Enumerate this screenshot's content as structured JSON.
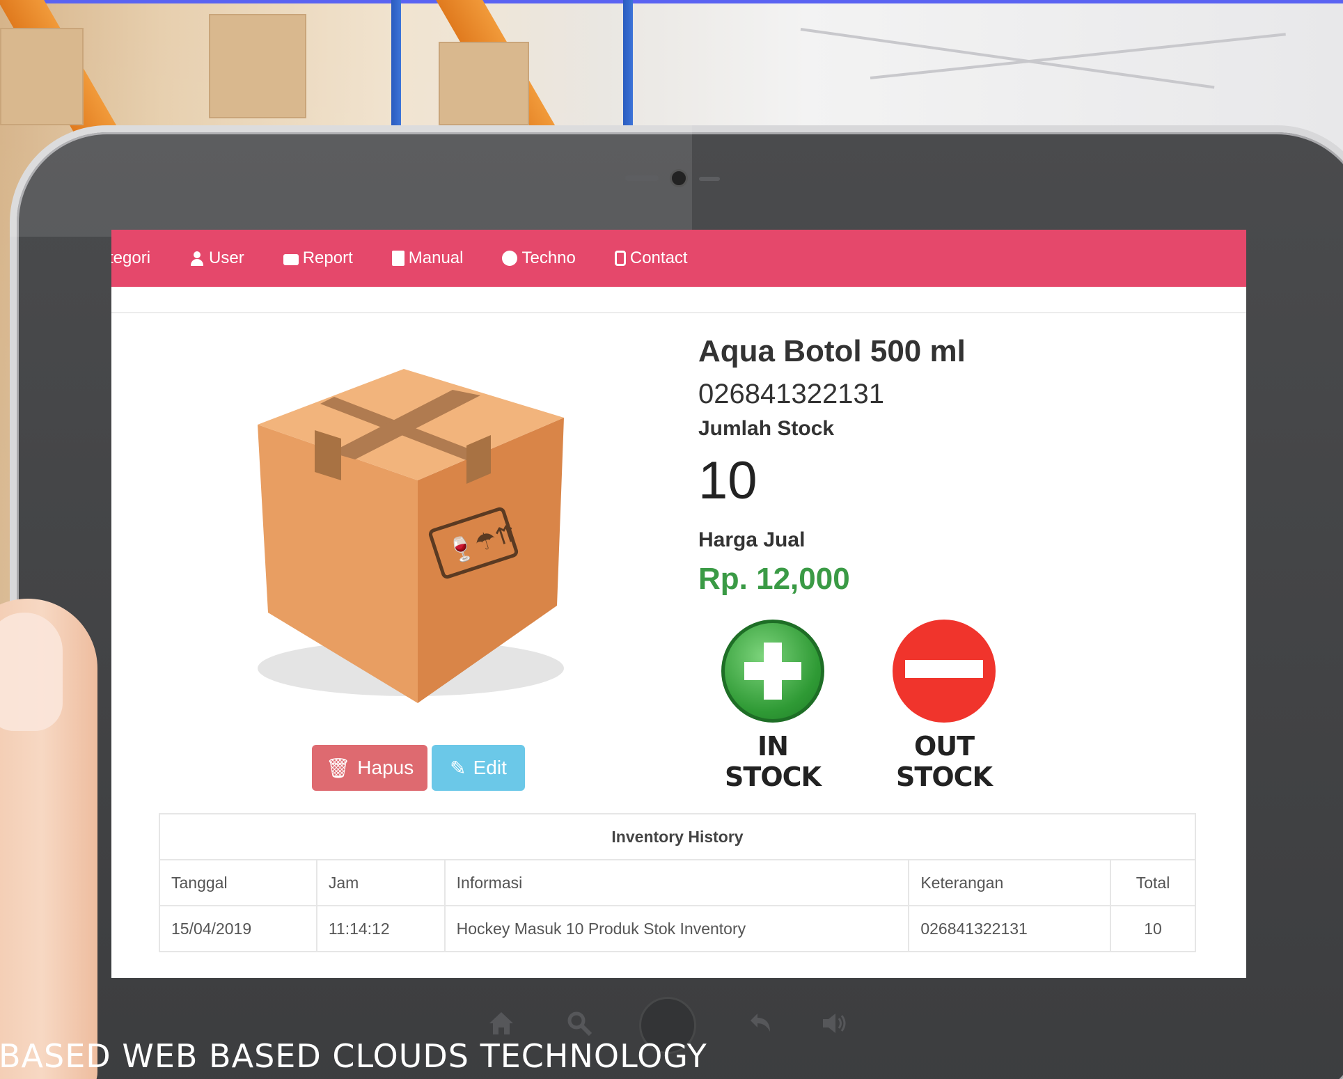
{
  "colors": {
    "navbar": "#e5486b",
    "price": "#3a9a45",
    "btn_hapus": "#de6a70",
    "btn_edit": "#6bc8e8",
    "in_stock": "#2f9a35",
    "out_stock": "#f0342c"
  },
  "nav": {
    "items": [
      {
        "label": "tegori",
        "icon": ""
      },
      {
        "label": "User",
        "icon": "user-icon"
      },
      {
        "label": "Report",
        "icon": "briefcase-icon"
      },
      {
        "label": "Manual",
        "icon": "book-icon"
      },
      {
        "label": "Techno",
        "icon": "globe-icon"
      },
      {
        "label": "Contact",
        "icon": "phone-icon"
      }
    ]
  },
  "product": {
    "name": "Aqua Botol 500 ml",
    "code": "026841322131",
    "stock_label": "Jumlah Stock",
    "stock_value": "10",
    "price_label": "Harga Jual",
    "price": "Rp. 12,000"
  },
  "actions": {
    "delete_label": "Hapus",
    "delete_icon": "trash-icon",
    "edit_label": "Edit",
    "edit_icon": "pencil-icon",
    "in_stock_label": "IN STOCK",
    "out_stock_label": "OUT STOCK"
  },
  "history": {
    "title": "Inventory History",
    "columns": [
      "Tanggal",
      "Jam",
      "Informasi",
      "Keterangan",
      "Total"
    ],
    "rows": [
      [
        "15/04/2019",
        "11:14:12",
        "Hockey Masuk 10 Produk Stok Inventory",
        "026841322131",
        "10"
      ]
    ]
  },
  "softkeys": [
    "home-icon",
    "search-icon",
    "back-icon",
    "volume-icon"
  ],
  "caption": "BASED WEB BASED CLOUDS TECHNOLOGY"
}
